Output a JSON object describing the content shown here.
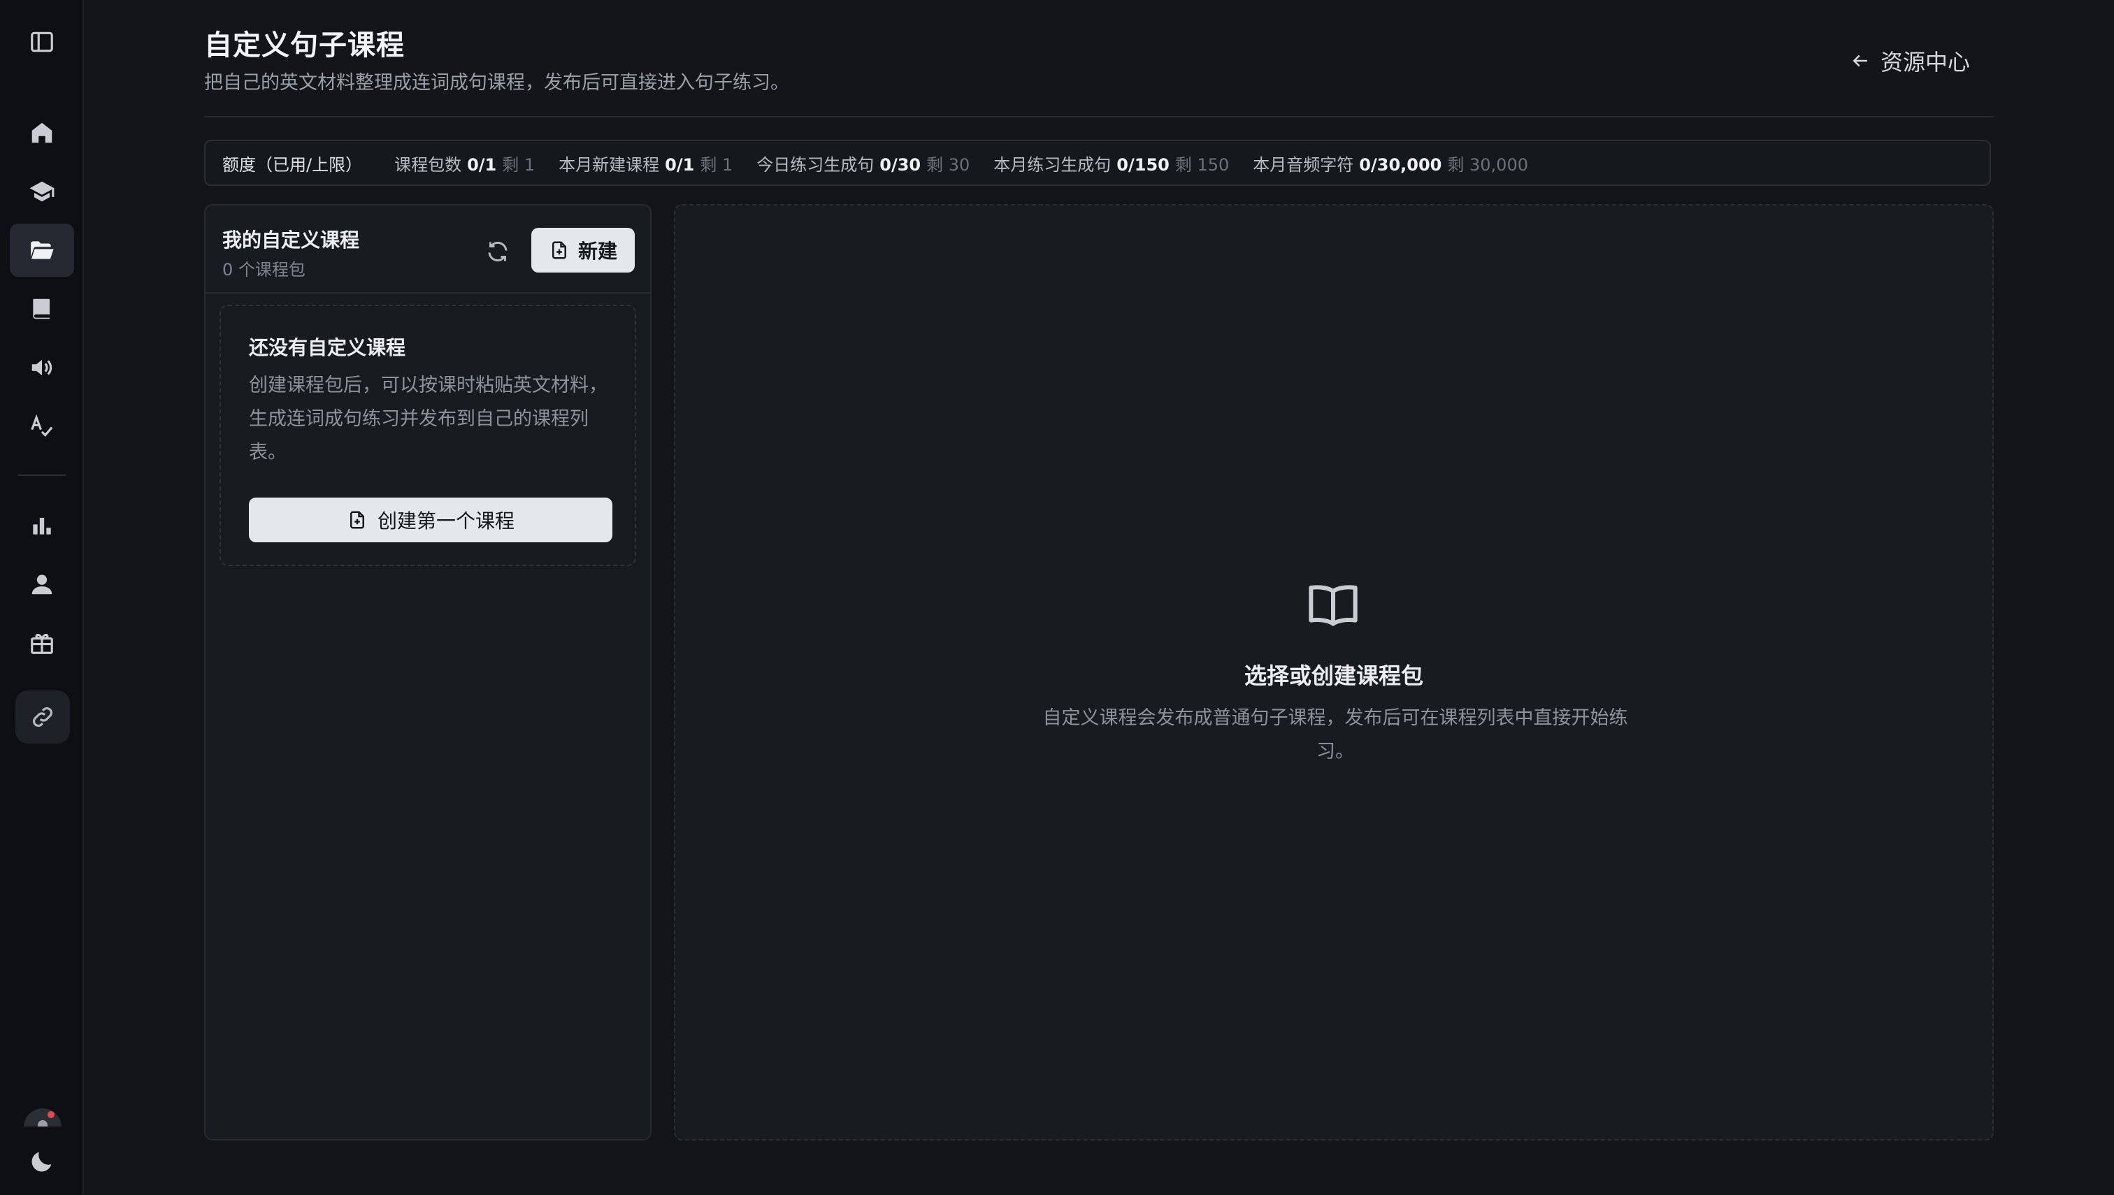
{
  "sidebar": {
    "items": [
      {
        "icon": "sidebar-toggle-icon"
      },
      {
        "icon": "home-icon"
      },
      {
        "icon": "graduation-cap-icon"
      },
      {
        "icon": "folder-open-icon",
        "active": true
      },
      {
        "icon": "book-icon"
      },
      {
        "icon": "speaker-icon"
      },
      {
        "icon": "spell-check-icon"
      },
      {
        "icon": "bar-chart-icon"
      },
      {
        "icon": "user-icon"
      },
      {
        "icon": "gift-icon"
      },
      {
        "icon": "link-icon"
      },
      {
        "icon": "bell-icon"
      },
      {
        "icon": "moon-icon"
      }
    ]
  },
  "header": {
    "title": "自定义句子课程",
    "subtitle": "把自己的英文材料整理成连词成句课程，发布后可直接进入句子练习。",
    "back_label": "资源中心"
  },
  "quota": {
    "label": "额度（已用/上限）",
    "items": [
      {
        "name": "课程包数",
        "value": "0/1",
        "remain": "剩 1"
      },
      {
        "name": "本月新建课程",
        "value": "0/1",
        "remain": "剩 1"
      },
      {
        "name": "今日练习生成句",
        "value": "0/30",
        "remain": "剩 30"
      },
      {
        "name": "本月练习生成句",
        "value": "0/150",
        "remain": "剩 150"
      },
      {
        "name": "本月音频字符",
        "value": "0/30,000",
        "remain": "剩 30,000"
      }
    ]
  },
  "courses_panel": {
    "title": "我的自定义课程",
    "count": "0 个课程包",
    "new_label": "新建",
    "empty": {
      "title": "还没有自定义课程",
      "description": "创建课程包后，可以按课时粘贴英文材料，生成连词成句练习并发布到自己的课程列表。",
      "button_label": "创建第一个课程"
    }
  },
  "detail_panel": {
    "title": "选择或创建课程包",
    "description": "自定义课程会发布成普通句子课程，发布后可在课程列表中直接开始练习。"
  },
  "colors": {
    "background": "#131519",
    "sidebar": "#0d0f12",
    "panel": "#181b20",
    "button": "#e4e7ec",
    "notification": "#e5484d"
  }
}
